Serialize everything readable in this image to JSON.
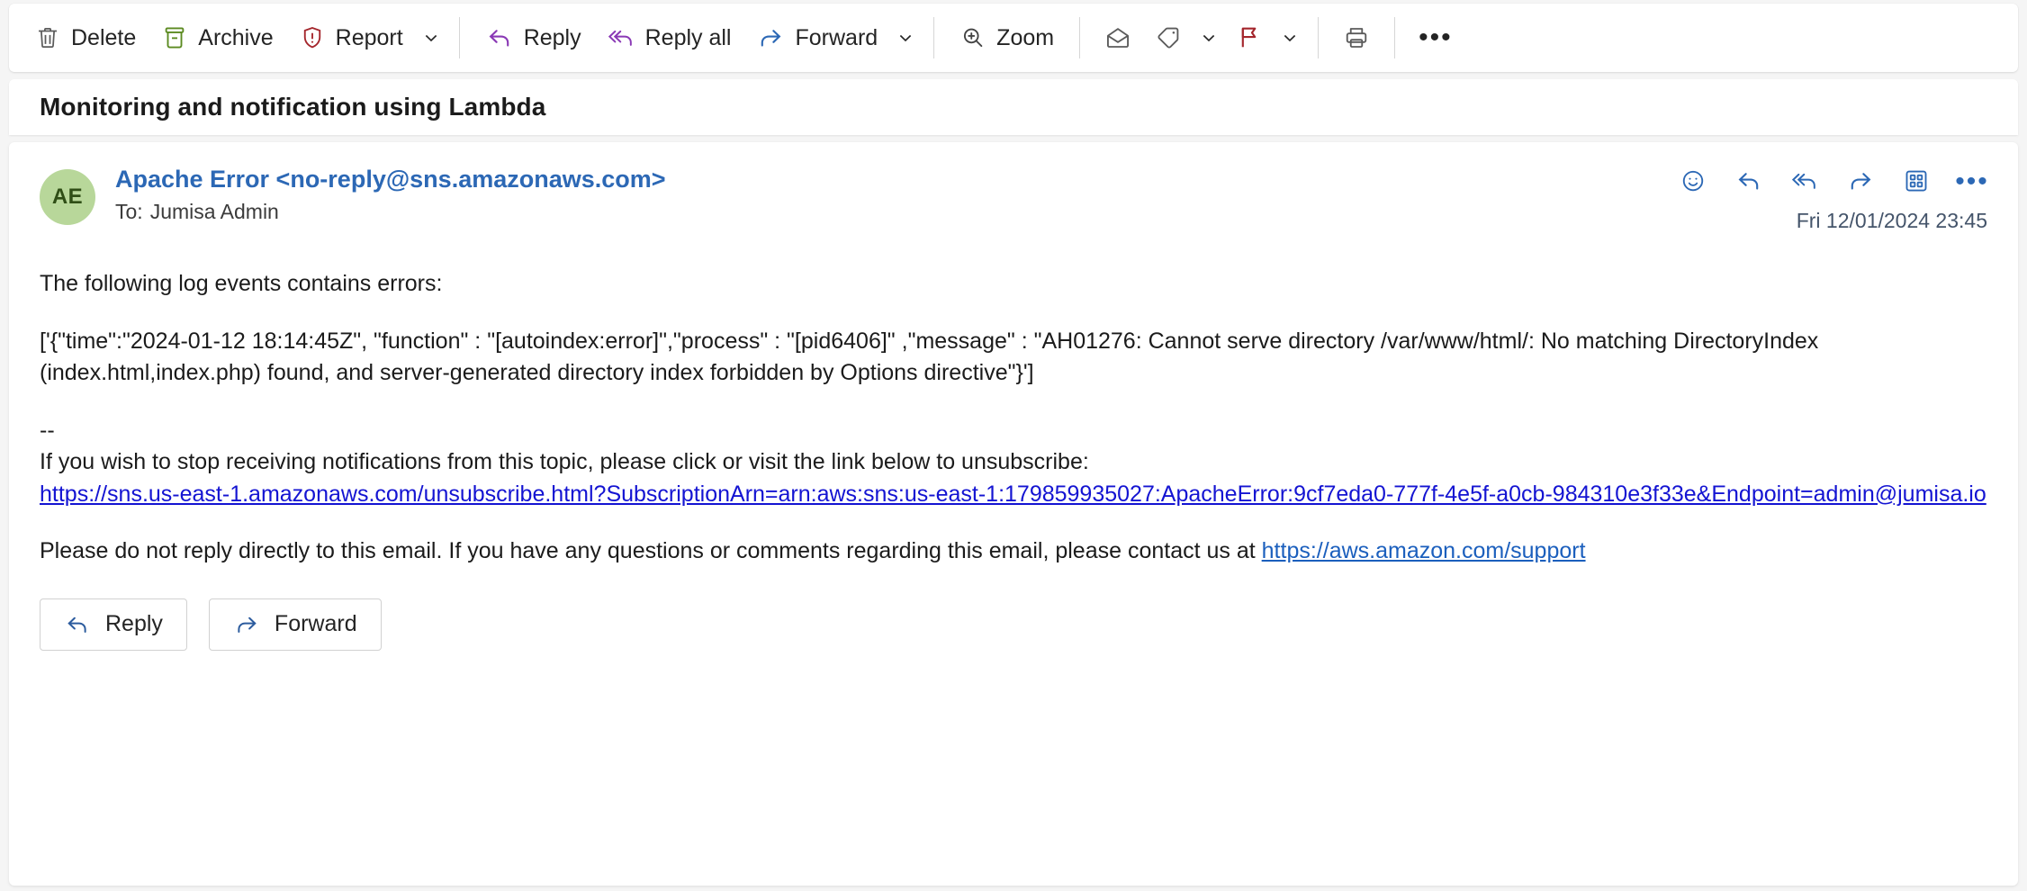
{
  "toolbar": {
    "delete_label": "Delete",
    "archive_label": "Archive",
    "report_label": "Report",
    "reply_label": "Reply",
    "reply_all_label": "Reply all",
    "forward_label": "Forward",
    "zoom_label": "Zoom",
    "ellipsis": "•••",
    "colors": {
      "delete_icon": "#5b5b5b",
      "archive_icon": "#5b8a20",
      "report_icon": "#a4262c",
      "reply_icon": "#8a39b5",
      "reply_all_icon": "#8a39b5",
      "forward_icon": "#2c68b5",
      "zoom_icon": "#444444",
      "flag_icon": "#a4262c",
      "text": "#242424"
    }
  },
  "subject": {
    "title": "Monitoring and notification using Lambda"
  },
  "message": {
    "avatar_initials": "AE",
    "avatar_bg": "#b8d79a",
    "avatar_fg": "#2f4e16",
    "from": "Apache Error <no-reply@sns.amazonaws.com>",
    "to_label": "To:",
    "to_name": "Jumisa Admin",
    "timestamp": "Fri 12/01/2024 23:45",
    "header_icons_ellipsis": "•••"
  },
  "body": {
    "intro": "The following log events contains errors:",
    "log_event": "['{\"time\":\"2024-01-12 18:14:45Z\", \"function\" : \"[autoindex:error]\",\"process\" : \"[pid6406]\" ,\"message\" : \"AH01276: Cannot serve directory /var/www/html/: No matching DirectoryIndex (index.html,index.php) found, and server-generated directory index forbidden by Options directive\"}']",
    "signature_dashes": "--",
    "unsubscribe_intro": "If you wish to stop receiving notifications from this topic, please click or visit the link below to unsubscribe:",
    "unsubscribe_link": "https://sns.us-east-1.amazonaws.com/unsubscribe.html?SubscriptionArn=arn:aws:sns:us-east-1:179859935027:ApacheError:9cf7eda0-777f-4e5f-a0cb-984310e3f33e&Endpoint=admin@jumisa.io",
    "closing_text": "Please do not reply directly to this email. If you have any questions or comments regarding this email, please contact us at ",
    "support_link": "https://aws.amazon.com/support"
  },
  "footer_actions": {
    "reply_label": "Reply",
    "forward_label": "Forward"
  }
}
